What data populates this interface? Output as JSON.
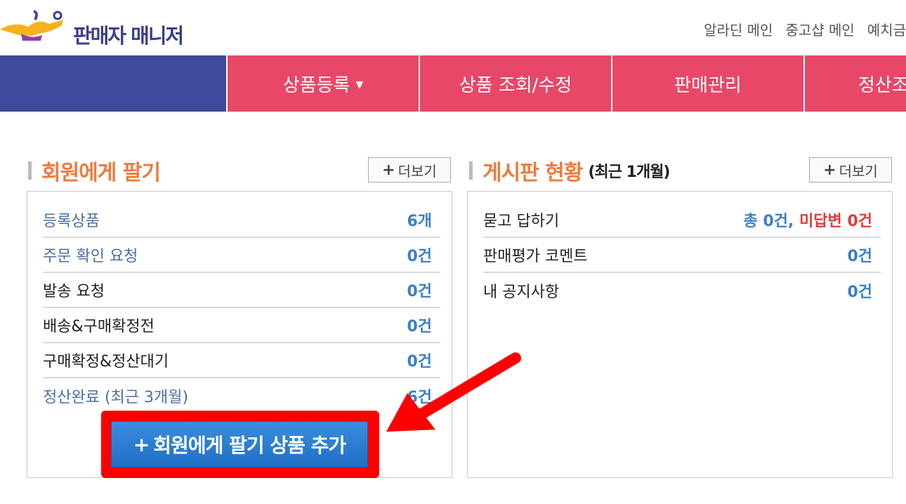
{
  "header": {
    "logo_text": "판매자 매니저",
    "links": [
      "알라딘 메인",
      "중고샵 메인",
      "예치금"
    ]
  },
  "nav": {
    "items": [
      {
        "label": "상품등록",
        "has_caret": true
      },
      {
        "label": "상품 조회/수정"
      },
      {
        "label": "판매관리"
      },
      {
        "label": "정산조회"
      }
    ]
  },
  "left_panel": {
    "title": "회원에게 팔기",
    "more_label": "더보기",
    "rows": [
      {
        "label": "등록상품",
        "value": "6개"
      },
      {
        "label": "주문 확인 요청",
        "value": "0건"
      },
      {
        "label": "발송 요청",
        "value": "0건"
      },
      {
        "label": "배송&구매확정전",
        "value": "0건"
      },
      {
        "label": "구매확정&정산대기",
        "value": "0건"
      },
      {
        "label": "정산완료 (최근 3개월)",
        "value": "6건"
      }
    ],
    "add_button_label": "회원에게 팔기 상품 추가"
  },
  "right_panel": {
    "title": "게시판 현황",
    "subtitle": "(최근 1개월)",
    "more_label": "더보기",
    "rows": [
      {
        "label": "묻고 답하기",
        "value_total": "총 0건,",
        "value_unanswered": "미답변 0건"
      },
      {
        "label": "판매평가 코멘트",
        "value": "0건"
      },
      {
        "label": "내 공지사항",
        "value": "0건"
      }
    ]
  },
  "colors": {
    "nav_blue": "#3e4a9a",
    "nav_pink": "#e84767",
    "title_orange": "#f07a3c",
    "value_blue": "#3a7fc8",
    "highlight_red": "#ff0000"
  }
}
